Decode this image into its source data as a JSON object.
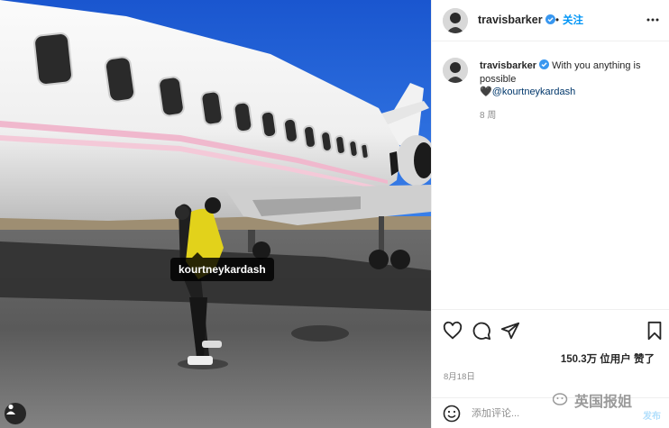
{
  "post": {
    "username": "travisbarker",
    "verified_icon": "verified-badge-icon",
    "follow_label": "关注",
    "dot": "•",
    "caption_text": "With you anything is possible",
    "caption_heart": "🖤",
    "caption_mention": "@kourtneykardash",
    "age": "8 周",
    "likes": "150.3万 位用户 赞了",
    "date": "8月18日",
    "photo_tag": "kourtneykardash",
    "comment_placeholder": "添加评论...",
    "post_label": "发布"
  },
  "watermark": {
    "text": "英国报姐"
  },
  "icons": {
    "more": "more-options-icon",
    "like": "heart-icon",
    "comment": "comment-icon",
    "share": "paper-plane-icon",
    "save": "bookmark-icon",
    "emoji": "emoji-icon",
    "user_tags": "user-tags-icon"
  },
  "colors": {
    "accent": "#0095f6",
    "mention": "#00376b",
    "secondary_text": "#8e8e8e",
    "border": "#efefef",
    "sky": "#1e5fd6",
    "jet_stripe": "#f0b8cd"
  }
}
